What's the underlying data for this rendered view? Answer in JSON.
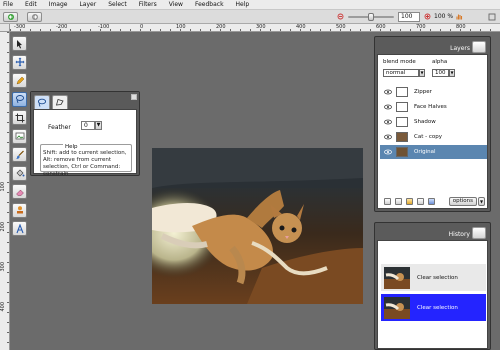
{
  "menu": [
    "File",
    "Edit",
    "Image",
    "Layer",
    "Select",
    "Filters",
    "View",
    "Feedback",
    "Help"
  ],
  "toolbar": {
    "zoom_value": "100",
    "zoom_percent": "100 %"
  },
  "rulers": {
    "horizontal": [
      "-300",
      "-200",
      "-100",
      "0",
      "100",
      "200",
      "300",
      "400",
      "500",
      "600",
      "700",
      "800"
    ],
    "vertical": [
      "100",
      "200",
      "300",
      "400"
    ]
  },
  "tools": [
    "select-icon",
    "move-icon",
    "pencil-icon",
    "lasso-icon",
    "crop-icon",
    "image-icon",
    "brush-icon",
    "fill-icon",
    "eraser-icon",
    "stamp-icon",
    "text-icon"
  ],
  "tool_options": {
    "feather_label": "Feather",
    "feather_value": "0",
    "help_title": "Help",
    "help_text": "Shift: add to current selection, Alt: remove from current selection, Ctrl or Command: constrain"
  },
  "layers_panel": {
    "title": "Layers",
    "blend_label": "blend mode",
    "alpha_label": "alpha",
    "blend_value": "normal",
    "alpha_value": "100",
    "layers": [
      {
        "name": "Zipper",
        "selected": false
      },
      {
        "name": "Face Halves",
        "selected": false
      },
      {
        "name": "Shadow",
        "selected": false
      },
      {
        "name": "Cat - copy",
        "selected": false
      },
      {
        "name": "Original",
        "selected": true
      }
    ],
    "options_label": "options"
  },
  "history_panel": {
    "title": "History",
    "items": [
      {
        "label": "Clear selection",
        "selected": false
      },
      {
        "label": "Clear selection",
        "selected": true
      }
    ]
  },
  "colors": {
    "workspace": "#6b6b6b",
    "panel": "#5b5b5b",
    "layer_selected": "#5b86b0",
    "history_selected": "#2424ff"
  }
}
